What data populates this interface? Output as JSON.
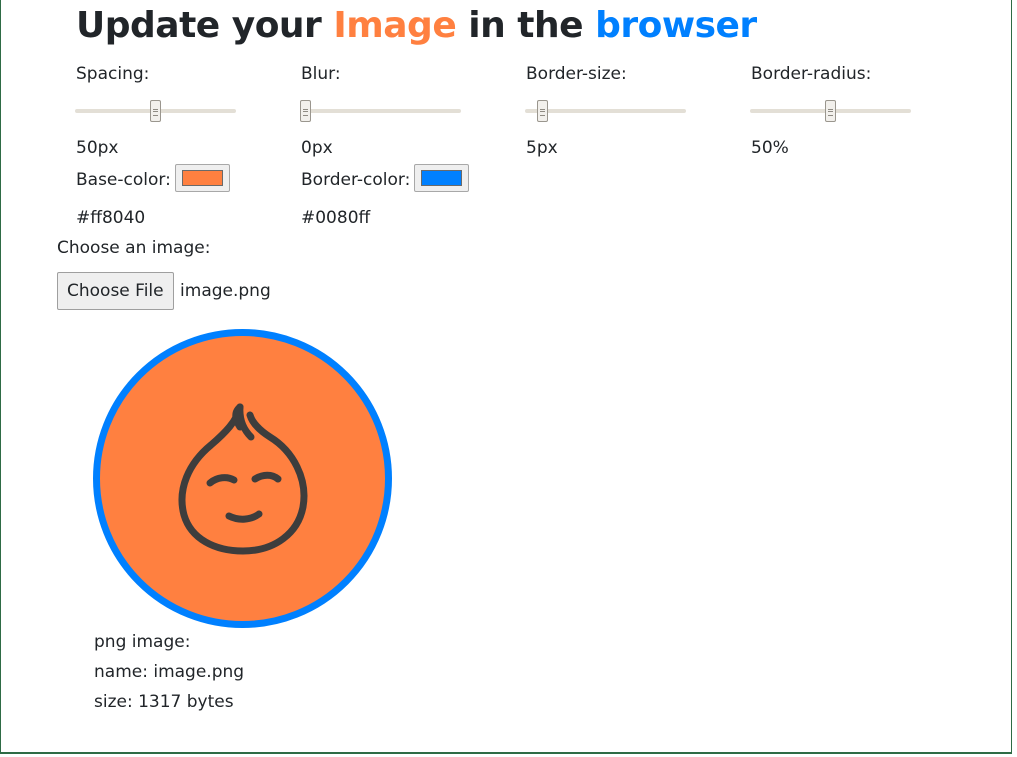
{
  "title": {
    "part1": "Update your ",
    "part2": "Image",
    "part3": " in the ",
    "part4": "browser"
  },
  "controls": {
    "spacing": {
      "label": "Spacing:",
      "value_text": "50px",
      "level": 0.5
    },
    "blur": {
      "label": "Blur:",
      "value_text": "0px",
      "level": 0.0
    },
    "border_size": {
      "label": "Border-size:",
      "value_text": "5px",
      "level": 0.08
    },
    "border_radius": {
      "label": "Border-radius:",
      "value_text": "50%",
      "level": 0.5
    },
    "base_color": {
      "label": "Base-color:",
      "value": "#ff8040"
    },
    "border_color": {
      "label": "Border-color:",
      "value": "#0080ff"
    }
  },
  "file": {
    "label": "Choose an image:",
    "button": "Choose File",
    "filename": "image.png"
  },
  "preview": {
    "fill": "#ff8040",
    "border": "#0080ff",
    "face_stroke": "#3d3d3d"
  },
  "info": {
    "type_line": "png image:",
    "name_line": "name: image.png",
    "size_line": "size: 1317 bytes"
  },
  "colors": {
    "accent_orange": "#ff8040",
    "accent_blue": "#0080ff",
    "text": "#212529"
  }
}
